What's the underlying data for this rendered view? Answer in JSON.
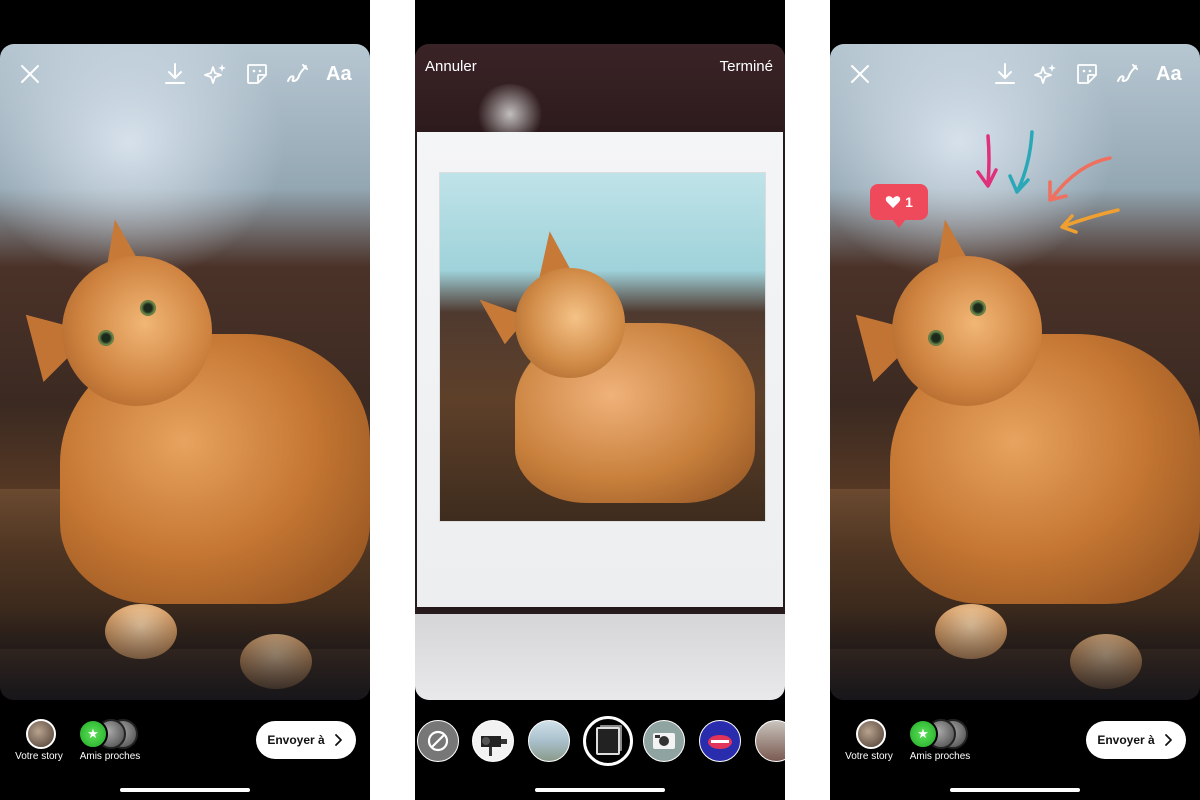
{
  "left_phone": {
    "toolbar": {
      "close_icon": "close-icon",
      "download_icon": "download-icon",
      "effects_icon": "sparkles-icon",
      "sticker_icon": "sticker-icon",
      "draw_icon": "draw-icon",
      "text_label": "Aa"
    },
    "share": {
      "your_story_label": "Votre story",
      "close_friends_label": "Amis proches",
      "send_label": "Envoyer à"
    }
  },
  "middle_phone": {
    "cancel_label": "Annuler",
    "done_label": "Terminé",
    "filters": [
      "none",
      "camera-filter",
      "landscape-filter",
      "polaroid-frame-filter",
      "instant-camera-filter",
      "lips-filter",
      "building-filter"
    ],
    "selected_filter": "polaroid-frame-filter"
  },
  "right_phone": {
    "toolbar": {
      "text_label": "Aa"
    },
    "like_sticker": {
      "count": "1",
      "color": "#ef4a5c"
    },
    "arrows_colors": [
      "#e0307a",
      "#2aa8b8",
      "#f07060",
      "#f0a030"
    ],
    "share": {
      "your_story_label": "Votre story",
      "close_friends_label": "Amis proches",
      "send_label": "Envoyer à"
    }
  }
}
